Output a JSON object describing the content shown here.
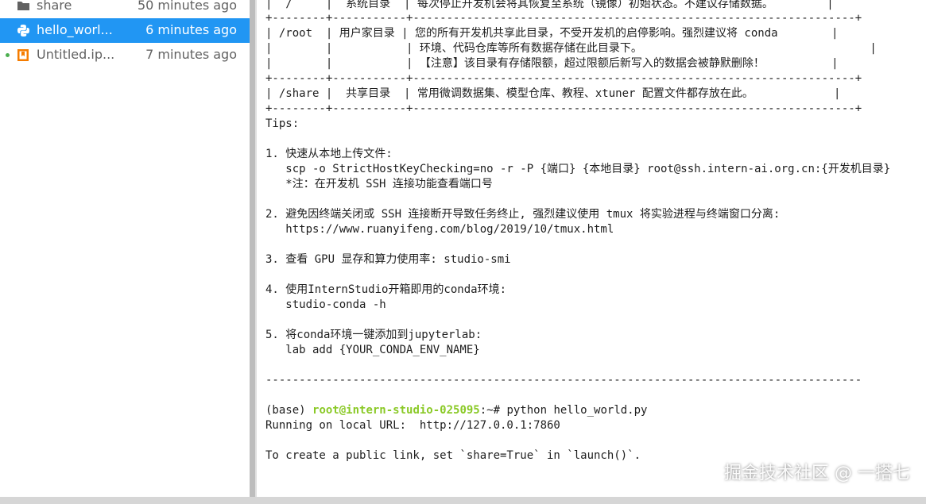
{
  "file_browser": {
    "files": [
      {
        "icon": "folder-icon",
        "name": "share",
        "modified": "50 minutes ago",
        "selected": false,
        "running": false
      },
      {
        "icon": "python-file-icon",
        "name": "hello_worl...",
        "modified": "6 minutes ago",
        "selected": true,
        "running": false
      },
      {
        "icon": "notebook-file-icon",
        "name": "Untitled.ip...",
        "modified": "7 minutes ago",
        "selected": false,
        "running": true
      }
    ]
  },
  "terminal": {
    "lines": [
      "|  /     |  系统目录  | 每次停止开发机会将其恢复至系统（镜像）初始状态。不建议存储数据。        |",
      "+--------+-----------+------------------------------------------------------------------+",
      "| /root  | 用户家目录 | 您的所有开发机共享此目录，不受开发机的启停影响。强烈建议将 conda        |",
      "|        |           | 环境、代码仓库等所有数据存储在此目录下。                                  |",
      "|        |           | 【注意】该目录有存储限额，超过限额后新写入的数据会被静默删除！          |",
      "+--------+-----------+------------------------------------------------------------------+",
      "| /share |  共享目录  | 常用微调数据集、模型仓库、教程、xtuner 配置文件都存放在此。            |",
      "+--------+-----------+------------------------------------------------------------------+",
      "Tips:",
      "",
      "1. 快速从本地上传文件:",
      "   scp -o StrictHostKeyChecking=no -r -P {端口} {本地目录} root@ssh.intern-ai.org.cn:{开发机目录}",
      "   *注：在开发机 SSH 连接功能查看端口号",
      "",
      "2. 避免因终端关闭或 SSH 连接断开导致任务终止, 强烈建议使用 tmux 将实验进程与终端窗口分离:",
      "   https://www.ruanyifeng.com/blog/2019/10/tmux.html",
      "",
      "3. 查看 GPU 显存和算力使用率: studio-smi",
      "",
      "4. 使用InternStudio开箱即用的conda环境:",
      "   studio-conda -h",
      "",
      "5. 将conda环境一键添加到jupyterlab:",
      "   lab add {YOUR_CONDA_ENV_NAME}",
      "",
      "-----------------------------------------------------------------------------------------",
      "",
      "",
      "Running on local URL:  http://127.0.0.1:7860",
      "",
      "To create a public link, set `share=True` in `launch()`."
    ],
    "prompt": {
      "env": "(base) ",
      "user_host": "root@intern-studio-025095",
      "cwd": ":~",
      "symbol": "# ",
      "command": "python hello_world.py"
    }
  },
  "watermark": "掘金技术社区 @ 一搭七",
  "colors": {
    "selection": "#2196f3",
    "prompt_green": "#8ac926",
    "running_dot": "#4caf50"
  }
}
